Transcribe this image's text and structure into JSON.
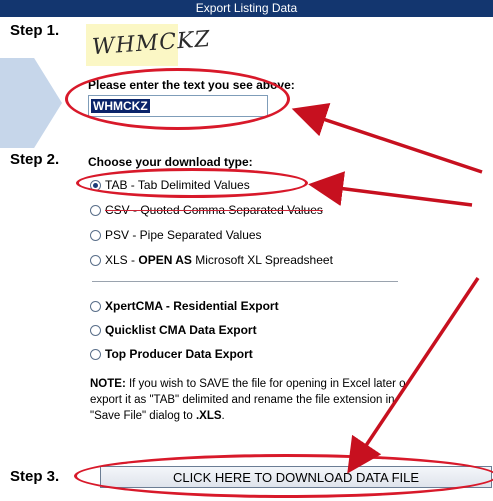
{
  "title": "Export Listing Data",
  "steps": {
    "step1": "Step 1.",
    "step2": "Step 2.",
    "step3": "Step 3."
  },
  "captcha": {
    "text": "WHMCKZ",
    "prompt": "Please enter the text you see above:",
    "input_value": "WHMCKZ"
  },
  "download_type": {
    "heading": "Choose your download type:",
    "options": [
      {
        "pre": "TAB - Tab Delimited Values",
        "strong": "",
        "post": "",
        "selected": true
      },
      {
        "pre": "CSV - Quoted Comma Separated Values",
        "strong": "",
        "post": "",
        "selected": false
      },
      {
        "pre": "PSV - Pipe Separated Values",
        "strong": "",
        "post": "",
        "selected": false
      },
      {
        "pre": "XLS - ",
        "strong": "OPEN AS",
        "post": " Microsoft XL Spreadsheet",
        "selected": false
      },
      {
        "pre": "",
        "strong": "XpertCMA - Residential Export",
        "post": "",
        "selected": false
      },
      {
        "pre": "",
        "strong": "Quicklist CMA Data Export",
        "post": "",
        "selected": false
      },
      {
        "pre": "",
        "strong": "Top Producer Data Export",
        "post": "",
        "selected": false
      }
    ]
  },
  "note": {
    "label": "NOTE:",
    "line1": " If you wish to SAVE the file for opening in Excel later o",
    "line2": "export it as \"TAB\" delimited and rename the file extension in",
    "line3_pre": "\"Save File\" dialog to ",
    "line3_strong": ".XLS",
    "line3_post": "."
  },
  "download_button": "CLICK HERE TO DOWNLOAD DATA FILE",
  "colors": {
    "title_bar": "#13366f",
    "annotation": "#d8192a",
    "captcha_bg": "#fbf7c5"
  }
}
